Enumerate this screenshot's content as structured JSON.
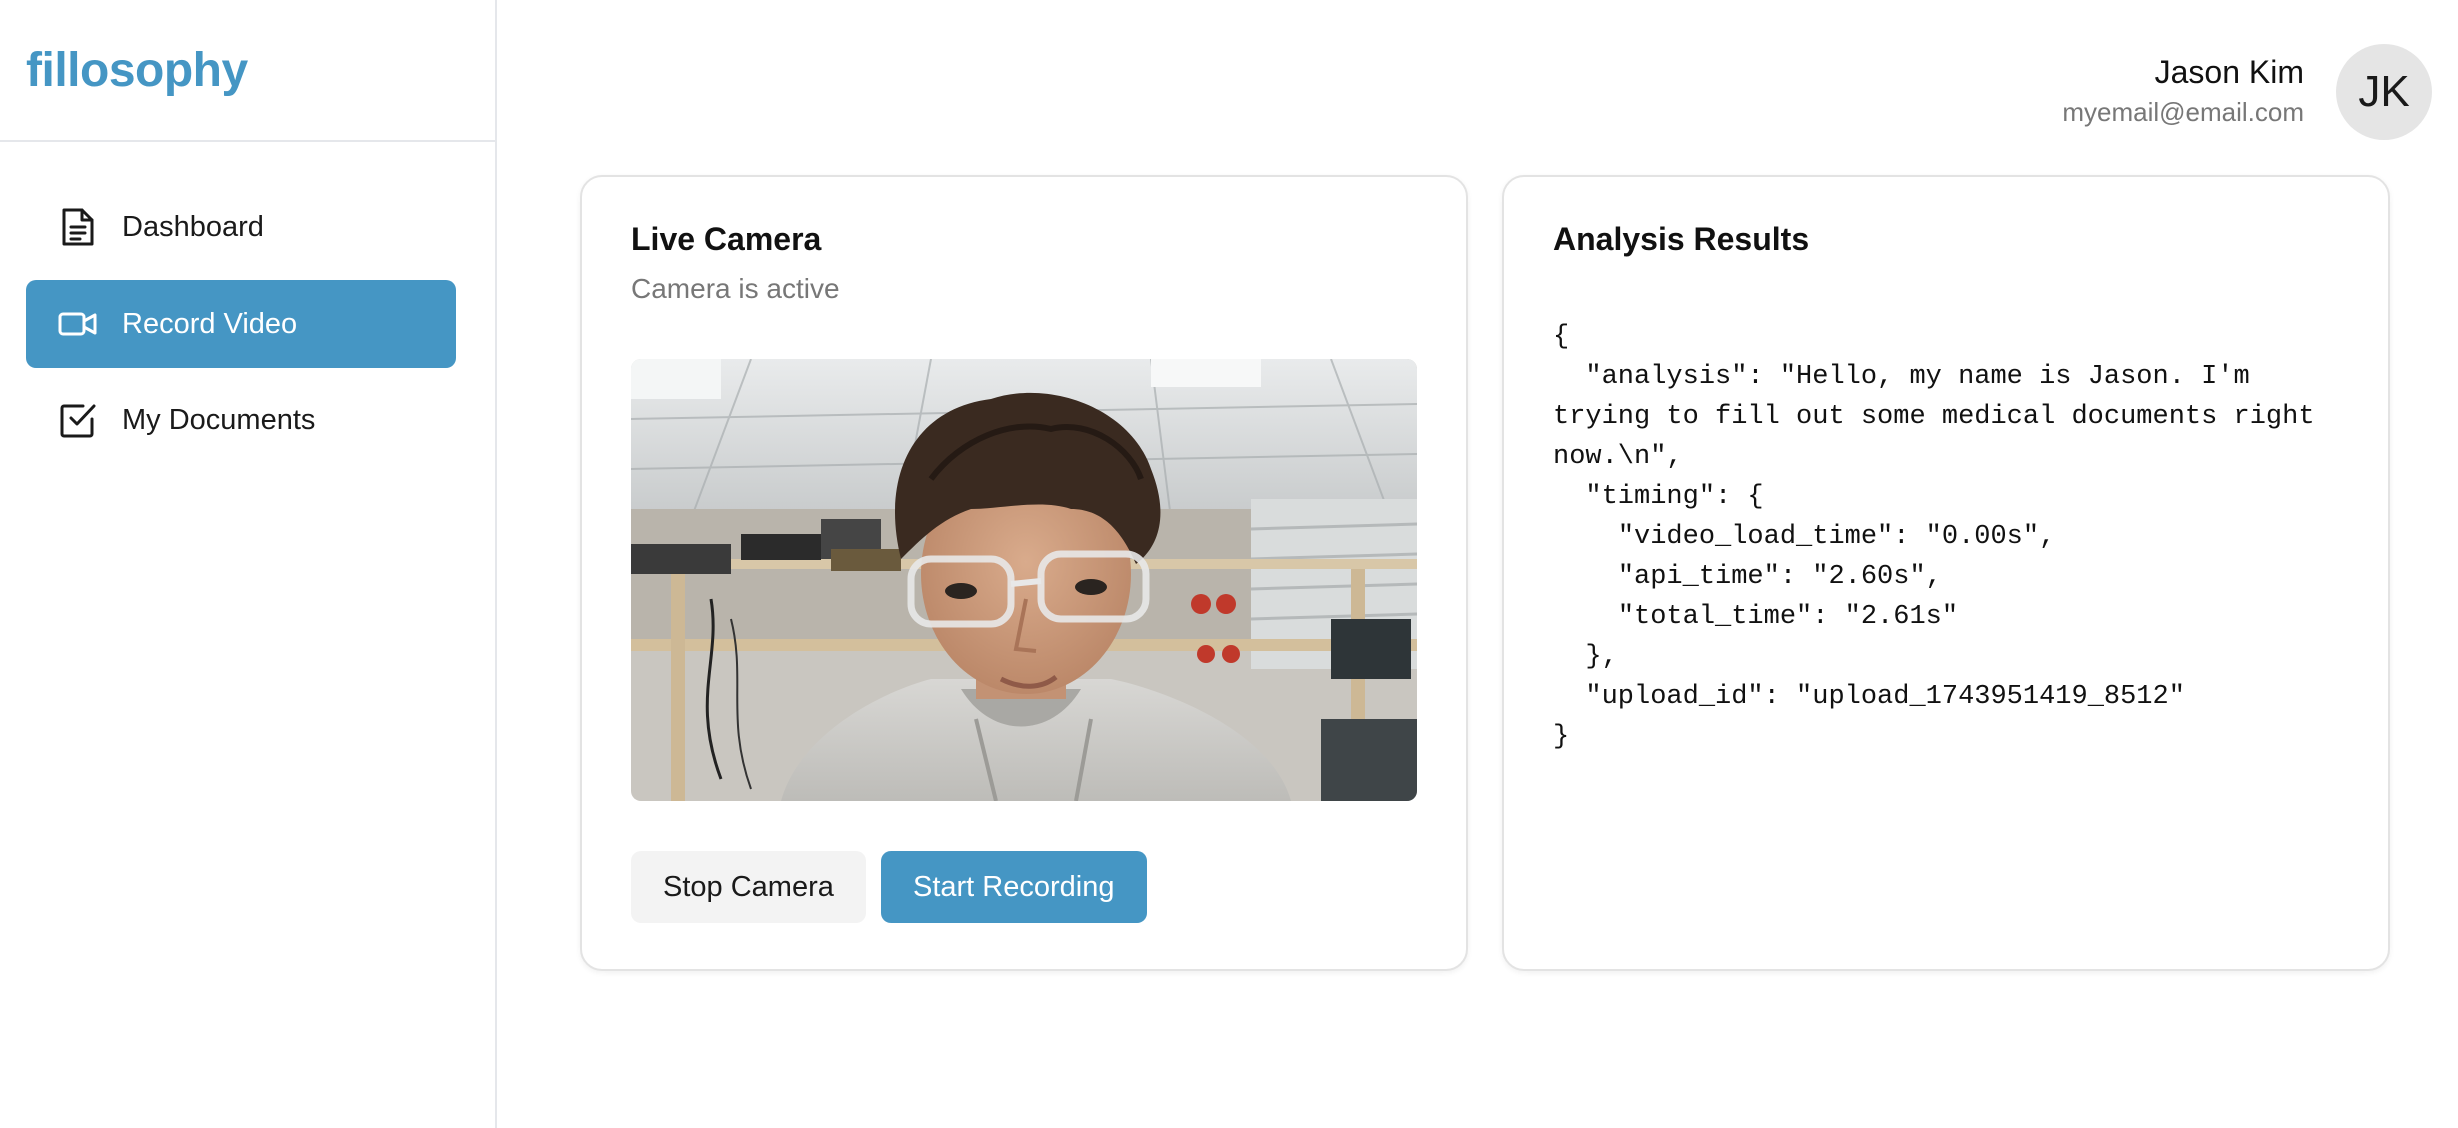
{
  "brand": "fillosophy",
  "nav": [
    {
      "label": "Dashboard",
      "icon": "document-icon",
      "active": false
    },
    {
      "label": "Record Video",
      "icon": "video-camera-icon",
      "active": true
    },
    {
      "label": "My Documents",
      "icon": "checkbox-icon",
      "active": false
    }
  ],
  "user": {
    "name": "Jason Kim",
    "email": "myemail@email.com",
    "initials": "JK"
  },
  "camera_card": {
    "title": "Live Camera",
    "status": "Camera is active",
    "stop_label": "Stop Camera",
    "record_label": "Start Recording"
  },
  "results_card": {
    "title": "Analysis Results",
    "json_text": "{\n  \"analysis\": \"Hello, my name is Jason. I'm trying to fill out some medical documents right now.\\n\",\n  \"timing\": {\n    \"video_load_time\": \"0.00s\",\n    \"api_time\": \"2.60s\",\n    \"total_time\": \"2.61s\"\n  },\n  \"upload_id\": \"upload_1743951419_8512\"\n}"
  },
  "colors": {
    "accent": "#4596c4",
    "border": "#e3e3e3",
    "muted_text": "#777777"
  }
}
